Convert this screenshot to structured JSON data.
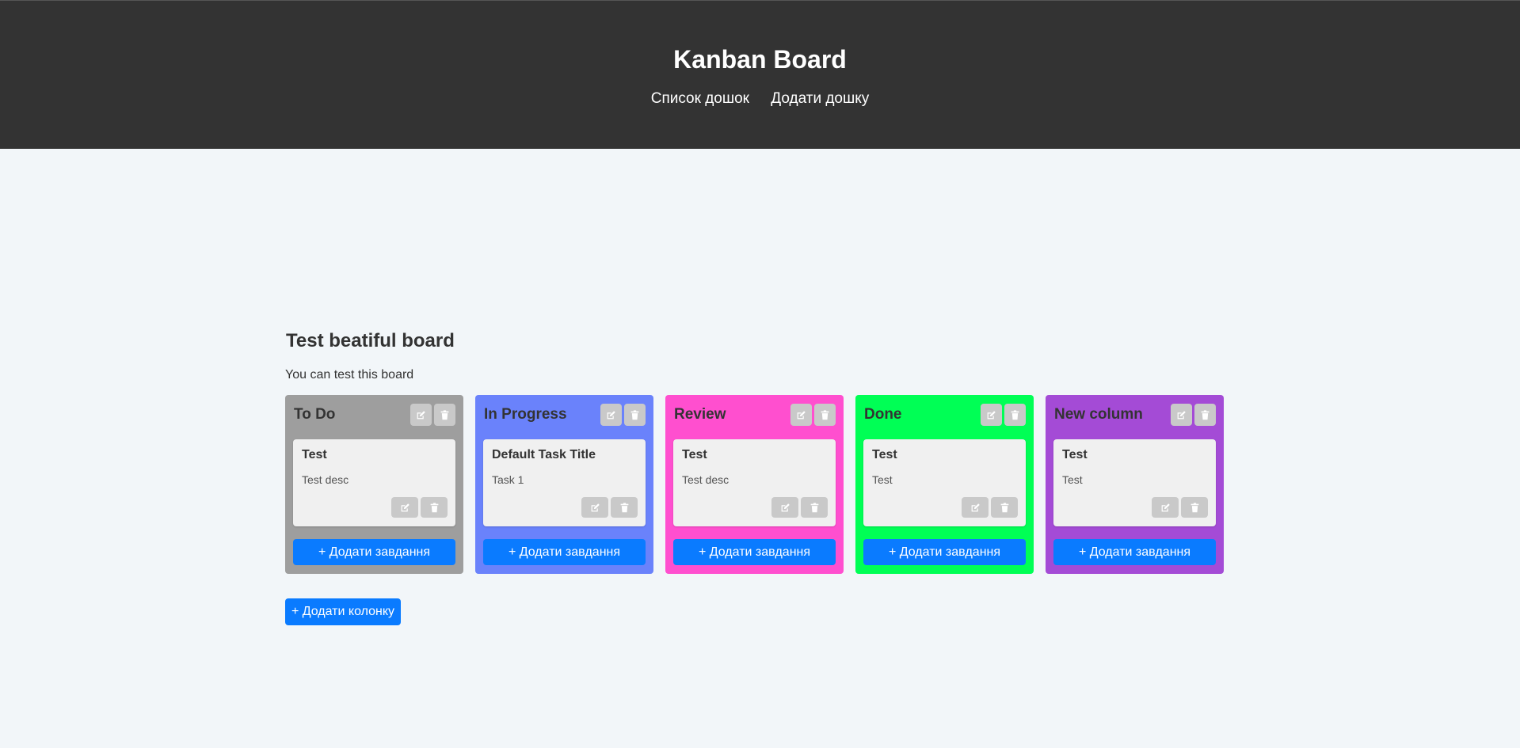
{
  "header": {
    "title": "Kanban Board",
    "nav": [
      {
        "label": "Список дошок"
      },
      {
        "label": "Додати дошку"
      }
    ]
  },
  "board": {
    "title": "Test beatiful board",
    "description": "You can test this board",
    "add_column_label": "+ Додати колонку",
    "columns": [
      {
        "title": "To Do",
        "color": "#9e9e9e",
        "task": {
          "title": "Test",
          "description": "Test desc"
        },
        "add_task_label": "+ Додати завдання"
      },
      {
        "title": "In Progress",
        "color": "#6a82fb",
        "task": {
          "title": "Default Task Title",
          "description": "Task 1"
        },
        "add_task_label": "+ Додати завдання"
      },
      {
        "title": "Review",
        "color": "#ff4fcf",
        "task": {
          "title": "Test",
          "description": "Test desc"
        },
        "add_task_label": "+ Додати завдання"
      },
      {
        "title": "Done",
        "color": "#00ff55",
        "task": {
          "title": "Test",
          "description": "Test"
        },
        "add_task_label": "+ Додати завдання"
      },
      {
        "title": "New column",
        "color": "#a44bd6",
        "task": {
          "title": "Test",
          "description": "Test"
        },
        "add_task_label": "+ Додати завдання"
      }
    ]
  },
  "icons": {
    "edit": "edit-icon",
    "delete": "trash-icon"
  },
  "colors": {
    "header_bg": "#333333",
    "page_bg": "#f2f6f9",
    "primary_button": "#0a7bff"
  }
}
